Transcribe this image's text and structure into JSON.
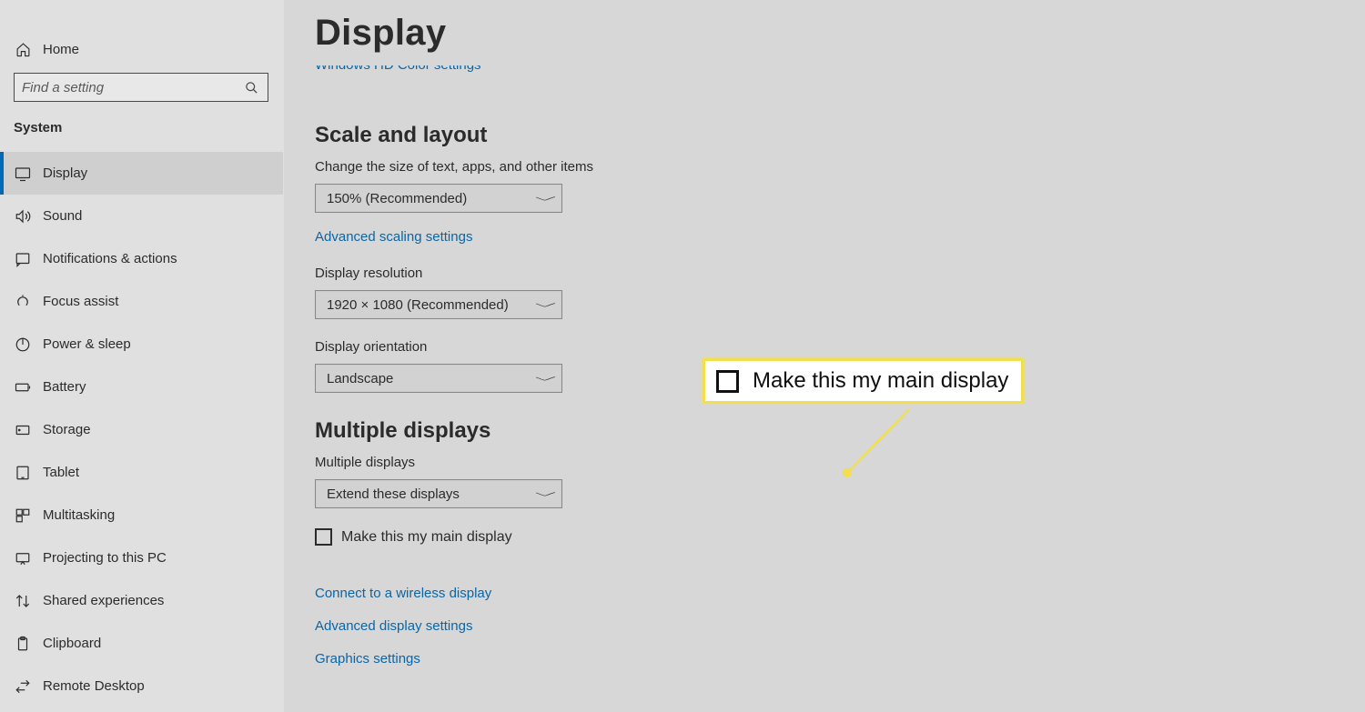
{
  "sidebar": {
    "home_label": "Home",
    "search_placeholder": "Find a setting",
    "category_label": "System",
    "items": [
      {
        "label": "Display",
        "icon": "display-icon",
        "selected": true
      },
      {
        "label": "Sound",
        "icon": "sound-icon"
      },
      {
        "label": "Notifications & actions",
        "icon": "notifications-icon"
      },
      {
        "label": "Focus assist",
        "icon": "focus-assist-icon"
      },
      {
        "label": "Power & sleep",
        "icon": "power-icon"
      },
      {
        "label": "Battery",
        "icon": "battery-icon"
      },
      {
        "label": "Storage",
        "icon": "storage-icon"
      },
      {
        "label": "Tablet",
        "icon": "tablet-icon"
      },
      {
        "label": "Multitasking",
        "icon": "multitasking-icon"
      },
      {
        "label": "Projecting to this PC",
        "icon": "project-icon"
      },
      {
        "label": "Shared experiences",
        "icon": "shared-icon"
      },
      {
        "label": "Clipboard",
        "icon": "clipboard-icon"
      },
      {
        "label": "Remote Desktop",
        "icon": "remote-icon"
      }
    ]
  },
  "main": {
    "title": "Display",
    "clipped_link": "Windows HD Color settings",
    "scale_section": {
      "title": "Scale and layout",
      "text_size_label": "Change the size of text, apps, and other items",
      "text_size_value": "150% (Recommended)",
      "advanced_scaling_link": "Advanced scaling settings",
      "resolution_label": "Display resolution",
      "resolution_value": "1920 × 1080 (Recommended)",
      "orientation_label": "Display orientation",
      "orientation_value": "Landscape"
    },
    "multi_section": {
      "title": "Multiple displays",
      "label": "Multiple displays",
      "value": "Extend these displays",
      "main_display_checkbox": "Make this my main display",
      "connect_link": "Connect to a wireless display",
      "advanced_link": "Advanced display settings",
      "graphics_link": "Graphics settings"
    }
  },
  "callout": {
    "text": "Make this my main display"
  }
}
